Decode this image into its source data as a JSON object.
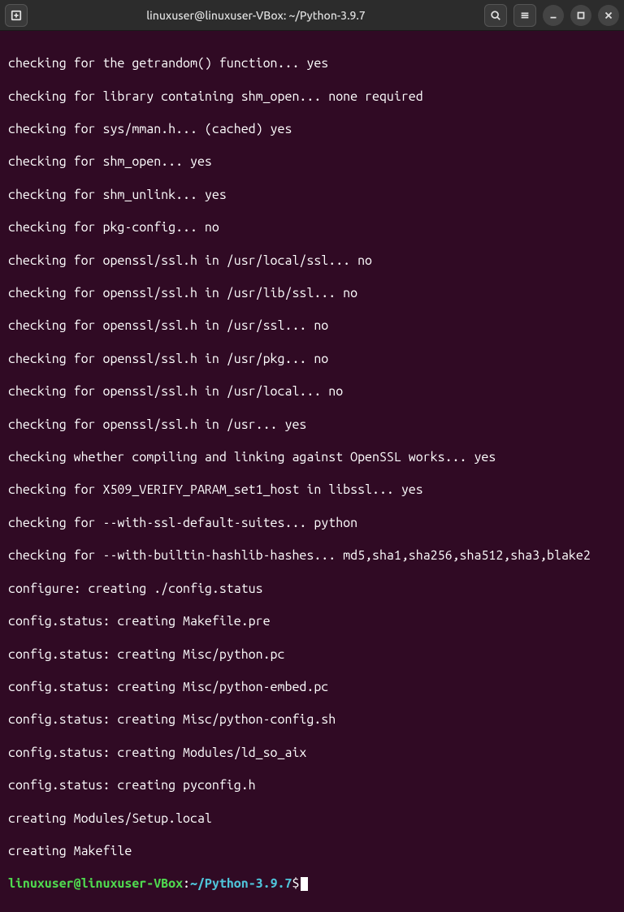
{
  "titlebar": {
    "title": "linuxuser@linuxuser-VBox: ~/Python-3.9.7"
  },
  "lines": [
    "checking for the getrandom() function... yes",
    "checking for library containing shm_open... none required",
    "checking for sys/mman.h... (cached) yes",
    "checking for shm_open... yes",
    "checking for shm_unlink... yes",
    "checking for pkg-config... no",
    "checking for openssl/ssl.h in /usr/local/ssl... no",
    "checking for openssl/ssl.h in /usr/lib/ssl... no",
    "checking for openssl/ssl.h in /usr/ssl... no",
    "checking for openssl/ssl.h in /usr/pkg... no",
    "checking for openssl/ssl.h in /usr/local... no",
    "checking for openssl/ssl.h in /usr... yes",
    "checking whether compiling and linking against OpenSSL works... yes",
    "checking for X509_VERIFY_PARAM_set1_host in libssl... yes",
    "checking for --with-ssl-default-suites... python",
    "checking for --with-builtin-hashlib-hashes... md5,sha1,sha256,sha512,sha3,blake2",
    "configure: creating ./config.status",
    "config.status: creating Makefile.pre",
    "config.status: creating Misc/python.pc",
    "config.status: creating Misc/python-embed.pc",
    "config.status: creating Misc/python-config.sh",
    "config.status: creating Modules/ld_so_aix",
    "config.status: creating pyconfig.h",
    "creating Modules/Setup.local",
    "creating Makefile"
  ],
  "prompt": {
    "userhost": "linuxuser@linuxuser-VBox",
    "colon": ":",
    "path": "~/Python-3.9.7",
    "dollar": "$"
  }
}
